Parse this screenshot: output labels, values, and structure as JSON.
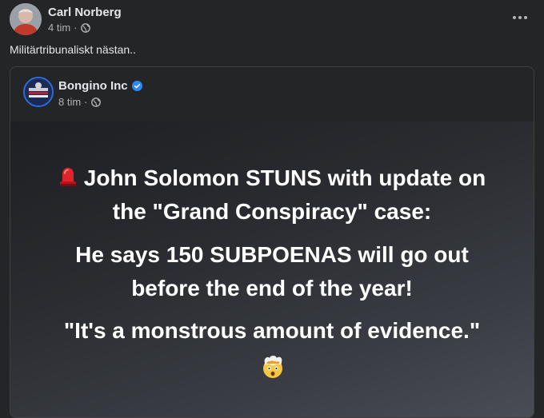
{
  "post": {
    "author": "Carl Norberg",
    "time": "4 tim",
    "dot": "·",
    "text": "Militärtribunaliskt nästan.."
  },
  "icons": {
    "more": "more-horizontal-icon",
    "audience": "globe-icon",
    "verified": "verified-badge-icon"
  },
  "shared": {
    "page_name": "Bongino Inc",
    "time": "8 tim",
    "dot": "·",
    "image": {
      "line1a": "John Solomon STUNS with update on",
      "line1b": "the \"Grand Conspiracy\" case:",
      "line2a": "He says 150 SUBPOENAS will go out",
      "line2b": "before the end of the year!",
      "line3": "\"It's a monstrous amount of evidence.\""
    }
  },
  "colors": {
    "background": "#242526",
    "text_primary": "#e4e6eb",
    "text_secondary": "#b0b3b8",
    "verified_blue": "#2d88ff",
    "card_border": "#3e4042"
  }
}
